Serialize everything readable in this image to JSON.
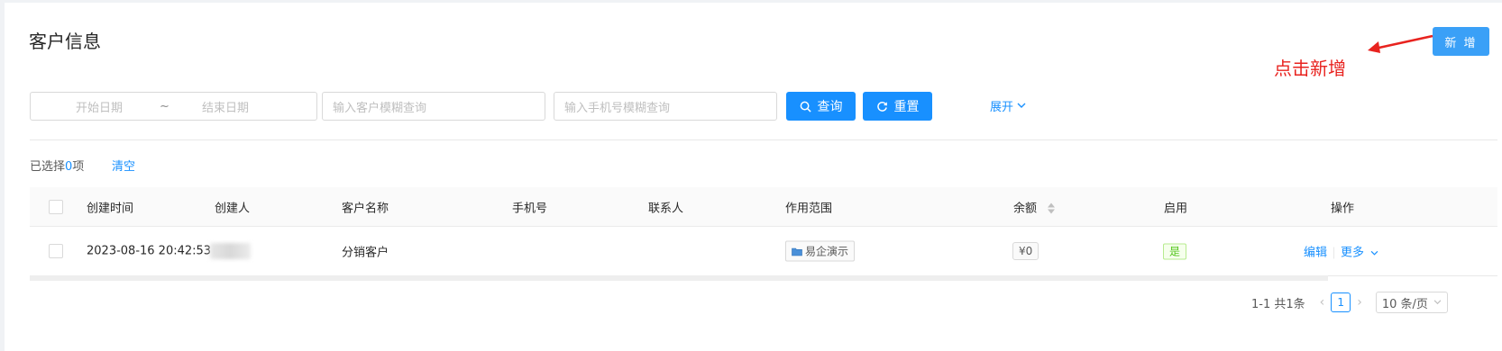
{
  "page": {
    "title": "客户信息"
  },
  "header": {
    "new_button": "新 增",
    "annotation": "点击新增"
  },
  "filters": {
    "start_placeholder": "开始日期",
    "range_separator": "~",
    "end_placeholder": "结束日期",
    "customer_placeholder": "输入客户模糊查询",
    "phone_placeholder": "输入手机号模糊查询",
    "search_label": "查询",
    "reset_label": "重置",
    "expand_label": "展开"
  },
  "selection": {
    "prefix": "已选择",
    "count": "0",
    "suffix": "项",
    "clear": "清空"
  },
  "table": {
    "columns": [
      "创建时间",
      "创建人",
      "客户名称",
      "手机号",
      "联系人",
      "作用范围",
      "余额",
      "启用",
      "操作"
    ],
    "rows": [
      {
        "created_at": "2023-08-16 20:42:53",
        "creator": "",
        "customer_name": "分销客户",
        "phone": "",
        "contact": "",
        "scope": "易企演示",
        "balance": "¥0",
        "enabled": "是",
        "actions": {
          "edit": "编辑",
          "more": "更多"
        }
      }
    ]
  },
  "pagination": {
    "summary": "1-1 共1条",
    "current_page": "1",
    "page_size": "10 条/页"
  },
  "colors": {
    "primary": "#1890ff",
    "annotation": "#e8231f",
    "success": "#52c41a"
  }
}
